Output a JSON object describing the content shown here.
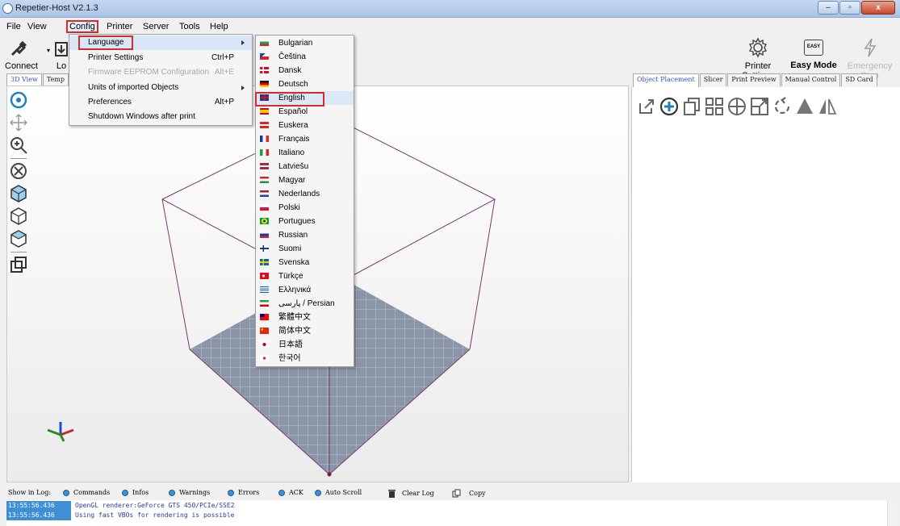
{
  "window": {
    "title": "Repetier-Host V2.1.3",
    "controls": {
      "minimize": "–",
      "maximize": "▫",
      "close": "x"
    }
  },
  "menubar": [
    "File",
    "View",
    "Config",
    "Printer",
    "Server",
    "Tools",
    "Help"
  ],
  "toolbar": {
    "connect": "Connect",
    "load": "Lo",
    "printer_settings": "Printer Settings",
    "easy_mode": "Easy Mode",
    "easy_badge": "EASY",
    "emergency_stop": "Emergency Stop"
  },
  "left_tabs": [
    "3D View",
    "Temp"
  ],
  "right_tabs": [
    "Object Placement",
    "Slicer",
    "Print Preview",
    "Manual Control",
    "SD Card"
  ],
  "config_menu": [
    {
      "label": "Language",
      "shortcut": "",
      "submenu": true,
      "disabled": false,
      "highlighted": true
    },
    {
      "label": "Printer Settings",
      "shortcut": "Ctrl+P",
      "submenu": false,
      "disabled": false,
      "highlighted": false
    },
    {
      "label": "Firmware EEPROM Configuration",
      "shortcut": "Alt+E",
      "submenu": false,
      "disabled": true,
      "highlighted": false
    },
    {
      "label": "Units of imported Objects",
      "shortcut": "",
      "submenu": true,
      "disabled": false,
      "highlighted": false
    },
    {
      "label": "Preferences",
      "shortcut": "Alt+P",
      "submenu": false,
      "disabled": false,
      "highlighted": false
    },
    {
      "label": "Shutdown Windows after print",
      "shortcut": "",
      "submenu": false,
      "disabled": false,
      "highlighted": false
    }
  ],
  "languages": [
    {
      "label": "Bulgarian",
      "flag": "bulgaria-flag-icon"
    },
    {
      "label": "Čeština",
      "flag": "czech-flag-icon"
    },
    {
      "label": "Dansk",
      "flag": "denmark-flag-icon"
    },
    {
      "label": "Deutsch",
      "flag": "germany-flag-icon"
    },
    {
      "label": "English",
      "flag": "uk-flag-icon",
      "selected": true
    },
    {
      "label": "Español",
      "flag": "spain-flag-icon"
    },
    {
      "label": "Euskera",
      "flag": "basque-flag-icon"
    },
    {
      "label": "Français",
      "flag": "france-flag-icon"
    },
    {
      "label": "Italiano",
      "flag": "italy-flag-icon"
    },
    {
      "label": "Latviešu",
      "flag": "latvia-flag-icon"
    },
    {
      "label": "Magyar",
      "flag": "hungary-flag-icon"
    },
    {
      "label": "Nederlands",
      "flag": "netherlands-flag-icon"
    },
    {
      "label": "Polski",
      "flag": "poland-flag-icon"
    },
    {
      "label": "Portugues",
      "flag": "brazil-flag-icon"
    },
    {
      "label": "Russian",
      "flag": "russia-flag-icon"
    },
    {
      "label": "Suomi",
      "flag": "finland-flag-icon"
    },
    {
      "label": "Svenska",
      "flag": "sweden-flag-icon"
    },
    {
      "label": "Türkçe",
      "flag": "turkey-flag-icon"
    },
    {
      "label": "Ελληνικά",
      "flag": "greece-flag-icon"
    },
    {
      "label": "پارسی / Persian",
      "flag": "iran-flag-icon"
    },
    {
      "label": "繁體中文",
      "flag": "taiwan-flag-icon"
    },
    {
      "label": "简体中文",
      "flag": "china-flag-icon"
    },
    {
      "label": "日本語",
      "flag": "japan-flag-icon"
    },
    {
      "label": "한국어",
      "flag": "korea-flag-icon"
    }
  ],
  "log": {
    "show_in_log_label": "Show in Log:",
    "options": [
      "Commands",
      "Infos",
      "Warnings",
      "Errors",
      "ACK",
      "Auto Scroll"
    ],
    "clear_log": "Clear Log",
    "copy": "Copy",
    "lines": [
      {
        "time": "13:55:56.436",
        "message": "OpenGL renderer:GeForce GTS 450/PCIe/SSE2"
      },
      {
        "time": "13:55:56.436",
        "message": "Using fast VBOs for rendering is possible"
      }
    ]
  },
  "colors": {
    "accent_blue": "#3f8fd6",
    "highlight_red": "#d62b2b",
    "cube_edge": "#7a3a6a",
    "bed_grid": "#8a96a8"
  }
}
